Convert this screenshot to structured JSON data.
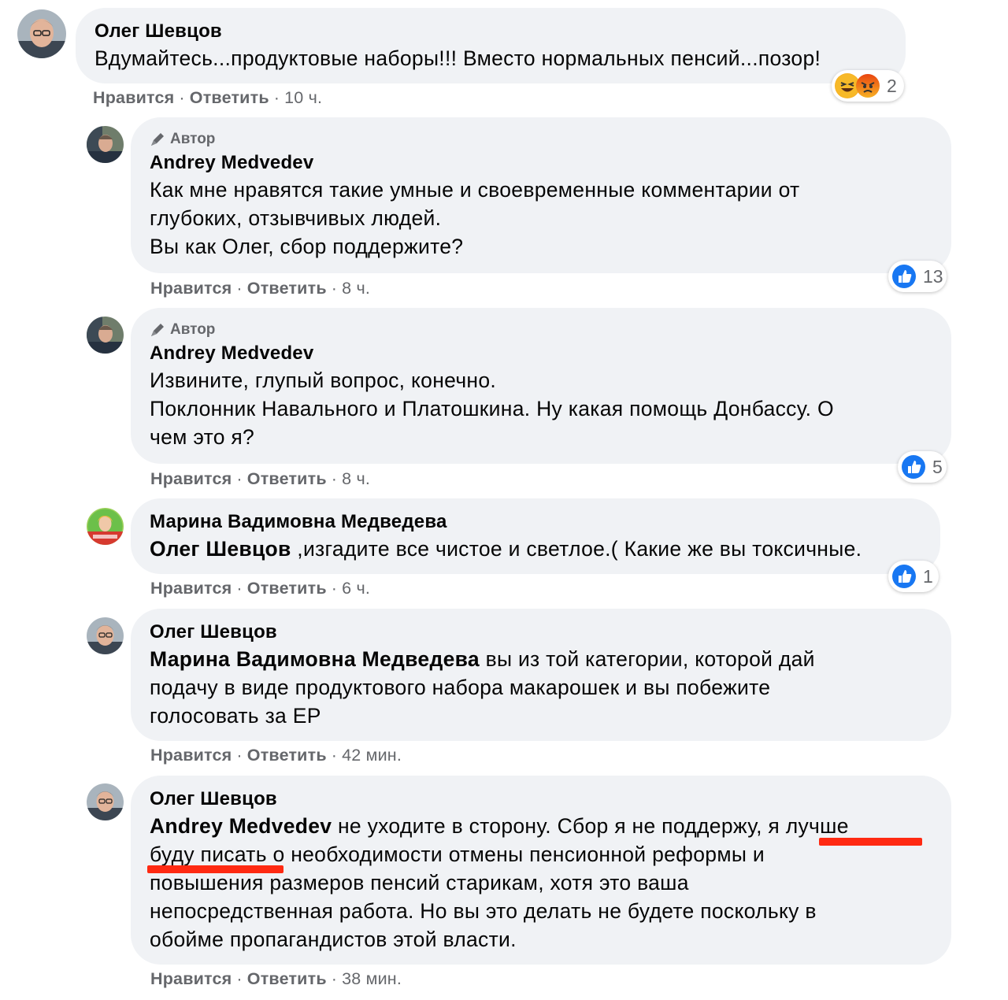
{
  "actions": {
    "like": "Нравится",
    "reply": "Ответить",
    "dot": "·"
  },
  "author_badge_label": "Автор",
  "comments": [
    {
      "author": "Олег Шевцов",
      "text": "Вдумайтесь...продуктовые наборы!!! Вместо нормальных пенсий...позор!",
      "time": "10 ч.",
      "reactions": {
        "types": [
          "haha",
          "angry"
        ],
        "count": "2"
      }
    },
    {
      "author": "Andrey Medvedev",
      "author_badge": true,
      "lines": [
        "Как мне нравятся такие умные и своевременные комментарии от",
        "глубоких, отзывчивых людей.",
        "Вы как Олег, сбор поддержите?"
      ],
      "time": "8 ч.",
      "reactions": {
        "types": [
          "like"
        ],
        "count": "13"
      }
    },
    {
      "author": "Andrey Medvedev",
      "author_badge": true,
      "lines": [
        "Извините, глупый вопрос, конечно.",
        "Поклонник Навального и Платошкина. Ну какая помощь Донбассу. О",
        "чем это я?"
      ],
      "time": "8 ч.",
      "reactions": {
        "types": [
          "like"
        ],
        "count": "5"
      }
    },
    {
      "author": "Марина Вадимовна Медведева",
      "mention": "Олег Шевцов",
      "text": " ,изгадите все чистое и светлое.( Какие же вы токсичные.",
      "time": "6 ч.",
      "reactions": {
        "types": [
          "like"
        ],
        "count": "1"
      }
    },
    {
      "author": "Олег Шевцов",
      "mention": "Марина Вадимовна Медведева",
      "line1_rest": " вы из той категории, которой дай",
      "lines": [
        "подачу в виде продуктового набора макарошек и вы побежите",
        "голосовать за ЕР"
      ],
      "time": "42 мин."
    },
    {
      "author": "Олег Шевцов",
      "mention": "Andrey Medvedev",
      "line1_rest": " не уходите в сторону. Сбор я не поддержу, я лучше",
      "lines": [
        "буду писать о необходимости отмены пенсионной реформы и",
        "повышения размеров пенсий старикам, хотя это ваша",
        "непосредственная работа. Но вы это делать не будете поскольку в",
        "обойме пропагандистов этой власти."
      ],
      "time": "38 мин."
    }
  ],
  "colors": {
    "bubble": "#f0f2f5",
    "meta_text": "#65676b",
    "like_blue": "#1877f2",
    "underline_red": "#ff2a12"
  }
}
